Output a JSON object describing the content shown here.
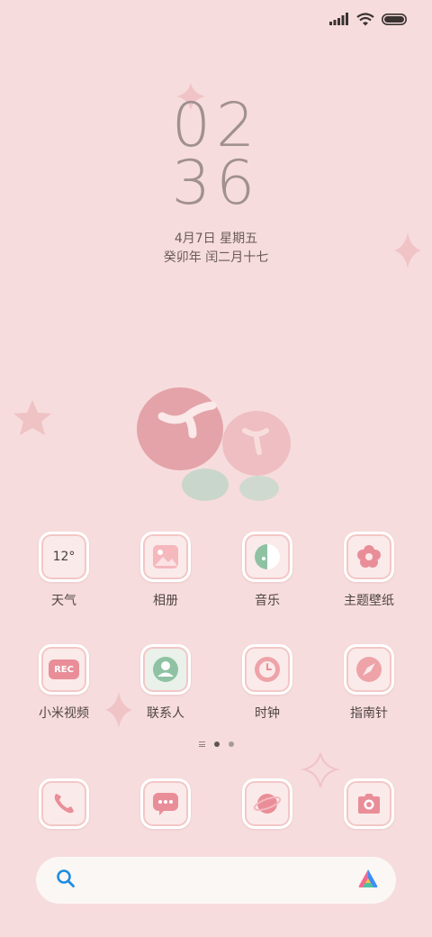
{
  "status_bar": {
    "signal_icon": "signal-bars-icon",
    "wifi_icon": "wifi-icon",
    "battery_icon": "battery-icon"
  },
  "clock": {
    "hours": "02",
    "minutes": "36",
    "date": "4月7日 星期五",
    "lunar_date": "癸卯年 闰二月十七"
  },
  "apps": [
    {
      "label": "天气",
      "icon": "weather-icon",
      "badge": "12°"
    },
    {
      "label": "相册",
      "icon": "gallery-icon"
    },
    {
      "label": "音乐",
      "icon": "music-icon"
    },
    {
      "label": "主题壁纸",
      "icon": "themes-flower-icon"
    },
    {
      "label": "小米视频",
      "icon": "video-rec-icon",
      "badge": "REC"
    },
    {
      "label": "联系人",
      "icon": "contacts-icon"
    },
    {
      "label": "时钟",
      "icon": "clock-icon"
    },
    {
      "label": "指南针",
      "icon": "compass-icon"
    }
  ],
  "dock": [
    {
      "icon": "phone-icon"
    },
    {
      "icon": "messages-icon"
    },
    {
      "icon": "browser-planet-icon"
    },
    {
      "icon": "camera-icon"
    }
  ],
  "page_indicator": {
    "pages": 2,
    "active": 1
  },
  "search": {
    "search_icon": "search-icon",
    "assistant_icon": "assistant-logo-icon"
  },
  "colors": {
    "background": "#f7dcdd",
    "icon_pink": "#e98e98",
    "icon_green": "#8fc2a3",
    "search_blue": "#1f8de0"
  }
}
